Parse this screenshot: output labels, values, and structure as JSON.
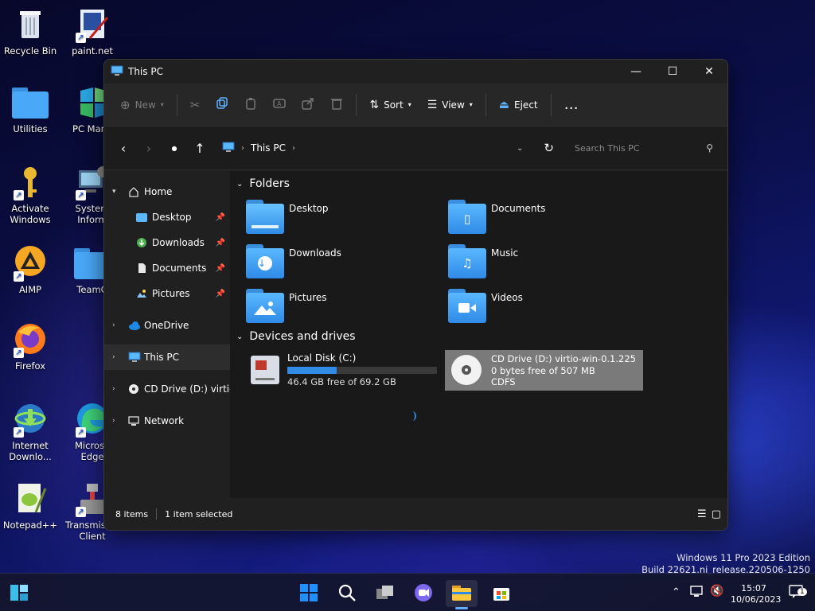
{
  "desktop": {
    "icons": [
      {
        "label": "Recycle Bin"
      },
      {
        "label": "paint.net"
      },
      {
        "label": "Utilities"
      },
      {
        "label": "PC Mana"
      },
      {
        "label": "Activate Windows"
      },
      {
        "label": "System Inform"
      },
      {
        "label": "AIMP"
      },
      {
        "label": "TeamO"
      },
      {
        "label": "Firefox"
      },
      {
        "label": "Internet Downlo..."
      },
      {
        "label": "Microso Edge"
      },
      {
        "label": "Notepad++"
      },
      {
        "label": "Transmis Qt Client"
      }
    ],
    "watermark": {
      "line1": "Windows 11 Pro 2023 Edition",
      "line2": "Build 22621.ni_release.220506-1250"
    }
  },
  "window": {
    "title": "This PC",
    "toolbar": {
      "new": "New",
      "sort": "Sort",
      "view": "View",
      "eject": "Eject",
      "more": "…"
    },
    "address": {
      "location": "This PC",
      "search_placeholder": "Search This PC"
    },
    "sidebar": [
      {
        "label": "Home"
      },
      {
        "label": "Desktop"
      },
      {
        "label": "Downloads"
      },
      {
        "label": "Documents"
      },
      {
        "label": "Pictures"
      },
      {
        "label": "OneDrive"
      },
      {
        "label": "This PC"
      },
      {
        "label": "CD Drive (D:) virtio-w"
      },
      {
        "label": "Network"
      }
    ],
    "sections": {
      "folders": "Folders",
      "devices": "Devices and drives"
    },
    "folders": [
      {
        "label": "Desktop"
      },
      {
        "label": "Documents"
      },
      {
        "label": "Downloads"
      },
      {
        "label": "Music"
      },
      {
        "label": "Pictures"
      },
      {
        "label": "Videos"
      }
    ],
    "drives": [
      {
        "name": "Local Disk (C:)",
        "free": "46.4 GB free of 69.2 GB",
        "used_fraction": 0.33
      },
      {
        "name": "CD Drive (D:) virtio-win-0.1.225",
        "free": "0 bytes free of 507 MB",
        "fs": "CDFS"
      }
    ],
    "status": {
      "items": "8 items",
      "selected": "1 item selected"
    }
  },
  "taskbar": {
    "time": "15:07",
    "date": "10/06/2023",
    "notif_count": "1"
  },
  "colors": {
    "accent": "#2f8be6",
    "window_bg": "#202020",
    "selected_drive": "#7a7a7a"
  }
}
